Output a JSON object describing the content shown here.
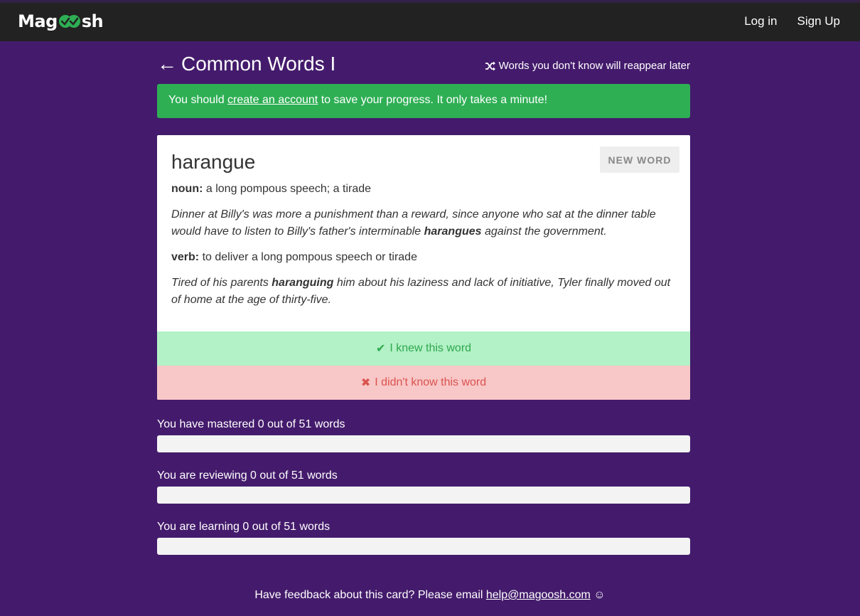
{
  "nav": {
    "logo_left": "Mag",
    "logo_right": "sh",
    "logo_mark_icon": "double-check-circle-icon",
    "login": "Log in",
    "signup": "Sign Up"
  },
  "header": {
    "back_arrow": "←",
    "title": "Common Words I",
    "shuffle_icon": "shuffle-icon",
    "reappear_note": "Words you don't know will reappear later"
  },
  "alert": {
    "before": "You should ",
    "link": "create an account",
    "after": " to save your progress. It only takes a minute!"
  },
  "card": {
    "word": "harangue",
    "new_word_label": "NEW WORD",
    "noun_pos": "noun:",
    "noun_def": " a long pompous speech; a tirade",
    "noun_example_before": "Dinner at Billy's was more a punishment than a reward, since anyone who sat at the dinner table would have to listen to Billy's father's interminable ",
    "noun_example_bold": "harangues",
    "noun_example_after": " against the government.",
    "verb_pos": "verb:",
    "verb_def": " to deliver a long pompous speech or tirade",
    "verb_example_before": "Tired of his parents ",
    "verb_example_bold": "haranguing",
    "verb_example_after": " him about his laziness and lack of initiative, Tyler finally moved out of home at the age of thirty-five.",
    "knew_icon": "✔",
    "knew_label": "I knew this word",
    "didnt_icon": "✖",
    "didnt_label": "I didn't know this word"
  },
  "progress": [
    {
      "label": "You have mastered 0 out of 51 words",
      "fraction": 0
    },
    {
      "label": "You are reviewing 0 out of 51 words",
      "fraction": 0
    },
    {
      "label": "You are learning 0 out of 51 words",
      "fraction": 0
    }
  ],
  "footer": {
    "before": "Have feedback about this card? Please email ",
    "email": "help@magoosh.com",
    "after": " ☺"
  },
  "colors": {
    "background": "#441b6c",
    "navbar": "#222222",
    "alert_green": "#2eaf54",
    "knew_bg": "#b3f1c6",
    "didnt_bg": "#f8c7c7"
  }
}
